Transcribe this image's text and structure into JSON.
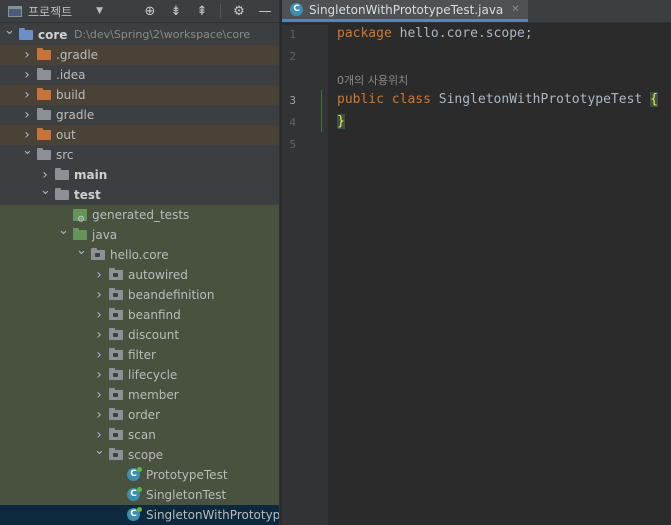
{
  "toolbar": {
    "title": "프로젝트",
    "icons": [
      "locate-icon",
      "expand-all-icon",
      "collapse-all-icon",
      "settings-icon",
      "minimize-icon"
    ]
  },
  "tree": [
    {
      "label": "core",
      "path": "D:\\dev\\Spring\\2\\workspace\\core",
      "level": 0,
      "expanded": true,
      "icon": "module-folder",
      "bold": true
    },
    {
      "label": ".gradle",
      "level": 1,
      "expanded": false,
      "icon": "excluded-folder"
    },
    {
      "label": ".idea",
      "level": 1,
      "expanded": false,
      "icon": "folder"
    },
    {
      "label": "build",
      "level": 1,
      "expanded": false,
      "icon": "excluded-folder"
    },
    {
      "label": "gradle",
      "level": 1,
      "expanded": false,
      "icon": "folder"
    },
    {
      "label": "out",
      "level": 1,
      "expanded": false,
      "icon": "excluded-folder"
    },
    {
      "label": "src",
      "level": 1,
      "expanded": true,
      "icon": "folder"
    },
    {
      "label": "main",
      "level": 2,
      "expanded": false,
      "icon": "folder",
      "bold": true
    },
    {
      "label": "test",
      "level": 2,
      "expanded": true,
      "icon": "folder",
      "bold": true
    },
    {
      "label": "generated_tests",
      "level": 3,
      "icon": "generated-folder"
    },
    {
      "label": "java",
      "level": 3,
      "expanded": true,
      "icon": "test-source-folder"
    },
    {
      "label": "hello.core",
      "level": 4,
      "expanded": true,
      "icon": "package"
    },
    {
      "label": "autowired",
      "level": 5,
      "expanded": false,
      "icon": "package"
    },
    {
      "label": "beandefinition",
      "level": 5,
      "expanded": false,
      "icon": "package"
    },
    {
      "label": "beanfind",
      "level": 5,
      "expanded": false,
      "icon": "package"
    },
    {
      "label": "discount",
      "level": 5,
      "expanded": false,
      "icon": "package"
    },
    {
      "label": "filter",
      "level": 5,
      "expanded": false,
      "icon": "package"
    },
    {
      "label": "lifecycle",
      "level": 5,
      "expanded": false,
      "icon": "package"
    },
    {
      "label": "member",
      "level": 5,
      "expanded": false,
      "icon": "package"
    },
    {
      "label": "order",
      "level": 5,
      "expanded": false,
      "icon": "package"
    },
    {
      "label": "scan",
      "level": 5,
      "expanded": false,
      "icon": "package"
    },
    {
      "label": "scope",
      "level": 5,
      "expanded": true,
      "icon": "package"
    },
    {
      "label": "PrototypeTest",
      "level": 6,
      "icon": "test-class"
    },
    {
      "label": "SingletonTest",
      "level": 6,
      "icon": "test-class"
    },
    {
      "label": "SingletonWithPrototypeTest",
      "level": 6,
      "icon": "test-class",
      "selected": true
    }
  ],
  "editor": {
    "tab": {
      "label": "SingletonWithPrototypeTest.java",
      "class_letter": "C"
    },
    "lines": [
      {
        "num": "1",
        "kw": "package",
        "text": " hello.core.scope;"
      },
      {
        "num": "2",
        "kw": "",
        "text": ""
      },
      {
        "num": "3",
        "kw": "public class",
        "text": " SingletonWithPrototypeTest ",
        "brace": "{"
      },
      {
        "num": "4",
        "kw": "",
        "text": "",
        "brace": "}"
      },
      {
        "num": "5",
        "kw": "",
        "text": ""
      }
    ],
    "usage_hint": "0개의 사용위치"
  },
  "colors": {
    "panel_bg": "#3c3f41",
    "editor_bg": "#2b2b2b",
    "keyword": "#cc7832",
    "selection": "#0d293e",
    "excluded_row": "#4a4237",
    "test_row": "#49513f"
  }
}
